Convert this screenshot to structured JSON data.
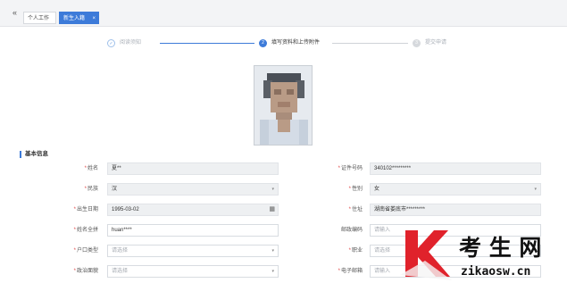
{
  "tabs": [
    {
      "label": "个人工作台"
    },
    {
      "label": "新生入籍",
      "close": "×"
    }
  ],
  "collapse_glyph": "«",
  "steps": [
    {
      "label": "阅读须知",
      "marker": "✓"
    },
    {
      "label": "填写资料和上传附件",
      "marker": "2"
    },
    {
      "label": "提交申请",
      "marker": "3"
    }
  ],
  "section_title": "基本信息",
  "left_fields": [
    {
      "label": "姓名",
      "required": "*",
      "value": "夏**",
      "kind": "text"
    },
    {
      "label": "民族",
      "required": "*",
      "value": "汉",
      "kind": "select"
    },
    {
      "label": "出生日期",
      "required": "*",
      "value": "1995-03-02",
      "kind": "date"
    },
    {
      "label": "姓名全拼",
      "required": "*",
      "value": "huan****",
      "kind": "input"
    },
    {
      "label": "户口类型",
      "required": "*",
      "value": "请选择",
      "kind": "select-placeholder"
    },
    {
      "label": "政治面貌",
      "required": "*",
      "value": "请选择",
      "kind": "select-placeholder"
    }
  ],
  "right_fields": [
    {
      "label": "证件号码",
      "required": "*",
      "value": "340102*********",
      "kind": "text"
    },
    {
      "label": "性别",
      "required": "*",
      "value": "女",
      "kind": "select"
    },
    {
      "label": "住址",
      "required": "*",
      "value": "湖南省娄底市*********",
      "kind": "text"
    },
    {
      "label": "邮政编码",
      "required": "",
      "value": "请输入",
      "kind": "input-placeholder"
    },
    {
      "label": "职业",
      "required": "*",
      "value": "请选择",
      "kind": "select-placeholder"
    },
    {
      "label": "电子邮箱",
      "required": "*",
      "value": "请输入",
      "kind": "input-placeholder"
    }
  ],
  "icons": {
    "caret": "▾",
    "calendar": "▦"
  },
  "watermark": {
    "brand": "考 生 网",
    "url": "zikaosw.cn"
  },
  "colors": {
    "accent": "#3d7bd9",
    "required": "#e04444",
    "watermark": "#e0222b"
  }
}
